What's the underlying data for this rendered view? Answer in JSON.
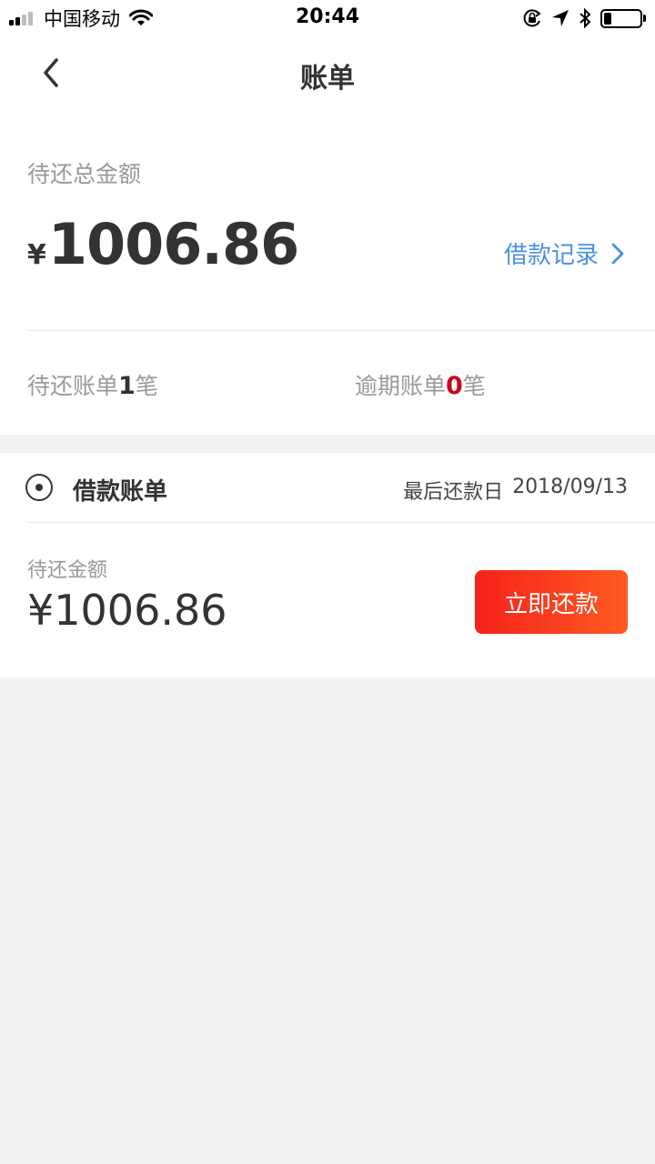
{
  "status_bar": {
    "carrier": "中国移动",
    "time": "20:44",
    "battery_level": 0.2,
    "icons": [
      "signal-icon",
      "wifi-icon",
      "rotation-lock-icon",
      "location-icon",
      "bluetooth-icon",
      "battery-icon"
    ]
  },
  "nav": {
    "title": "账单",
    "back_icon": "chevron-left-icon"
  },
  "summary": {
    "total_label": "待还总金额",
    "currency": "¥",
    "total_amount": "1006.86",
    "loan_record_label": "借款记录",
    "pending_prefix": "待还账单",
    "pending_count": "1",
    "pending_suffix": "笔",
    "overdue_prefix": "逾期账单",
    "overdue_count": "0",
    "overdue_suffix": "笔"
  },
  "bill": {
    "title": "借款账单",
    "due_label": "最后还款日",
    "due_date": "2018/09/13",
    "pending_label": "待还金额",
    "pending_amount": "¥1006.86",
    "repay_button": "立即还款"
  },
  "colors": {
    "accent_blue": "#4a90e2",
    "overdue_red": "#d0021b",
    "button_gradient_start": "#f5221b",
    "button_gradient_end": "#ff5a22",
    "page_background": "#f2f2f2"
  }
}
